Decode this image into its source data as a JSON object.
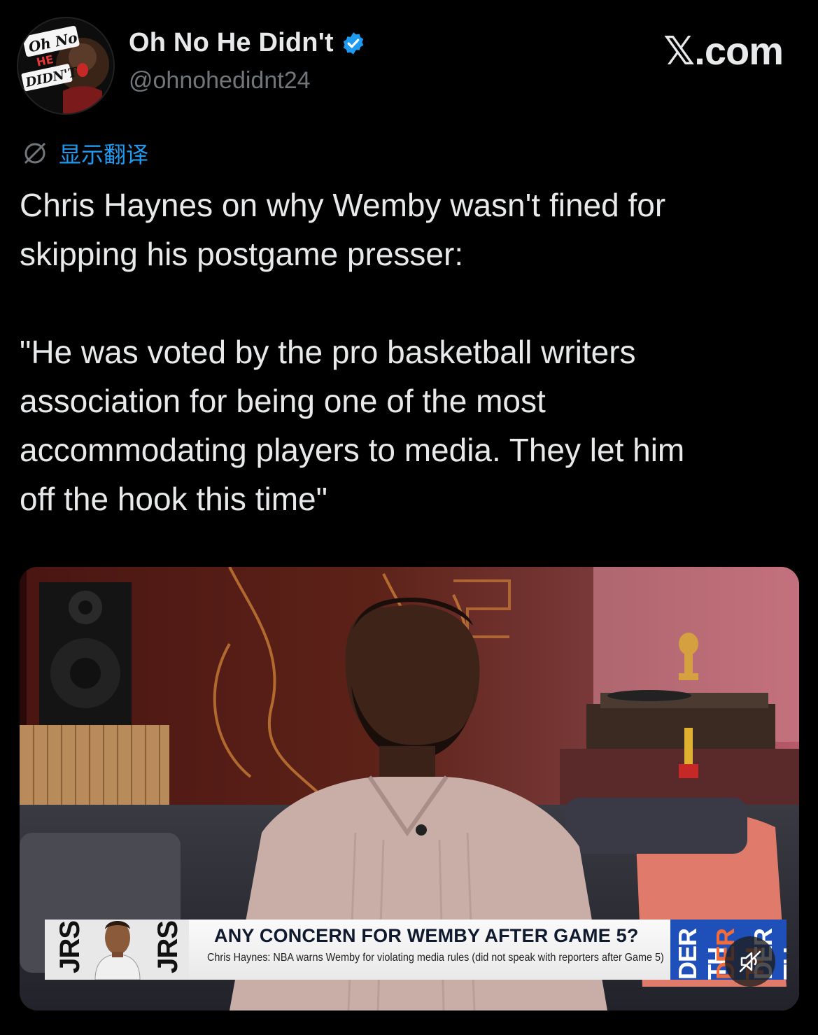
{
  "author": {
    "display_name": "Oh No He Didn't",
    "handle": "@ohnohedidnt24",
    "verified": true,
    "avatar_text": "Oh No He Didn't"
  },
  "brand": "𝕏.com",
  "translate": {
    "icon": "translate-globe-icon",
    "label": "显示翻译"
  },
  "tweet": {
    "text": "Chris Haynes on why Wemby wasn't fined for\nskipping his postgame presser:\n\n\"He was voted by the pro basketball writers\nassociation for being one of the most\naccommodating players to media. They let him\noff the hook this time\""
  },
  "video": {
    "lower_third": {
      "left_team_text": "JRS",
      "headline": "ANY CONCERN FOR WEMBY AFTER GAME 5?",
      "subheadline": "Chris Haynes: NBA warns Wemby for violating media rules (did not speak with reporters after Game 5)",
      "right_team_text": "DER TH"
    },
    "mute_icon": "speaker-muted-icon"
  },
  "colors": {
    "background": "#000000",
    "text": "#e7e9ea",
    "muted": "#71767b",
    "link": "#1d9bf0",
    "verified": "#1d9bf0"
  }
}
